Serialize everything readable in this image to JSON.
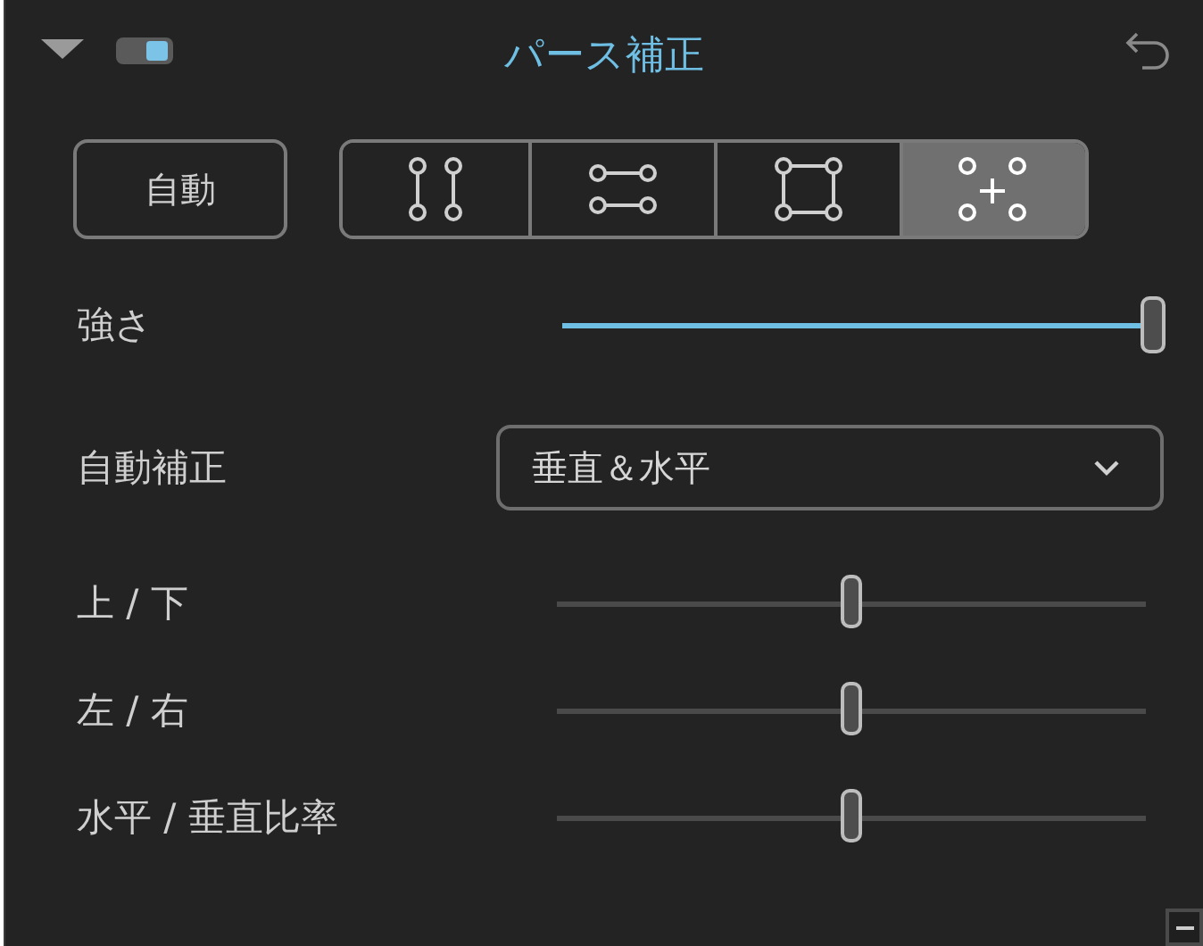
{
  "panel": {
    "expanded": true,
    "enabled": true,
    "title": "パース補正"
  },
  "auto_button": "自動",
  "modes": [
    {
      "kind": "vertical",
      "selected": false
    },
    {
      "kind": "horizontal",
      "selected": false
    },
    {
      "kind": "full",
      "selected": false
    },
    {
      "kind": "guided",
      "selected": true
    }
  ],
  "strength": {
    "label": "強さ",
    "level": 1
  },
  "auto_correction": {
    "label": "自動補正",
    "value": "垂直＆水平"
  },
  "sliders": [
    {
      "label": "上 / 下",
      "level": 0.5
    },
    {
      "label": "左 / 右",
      "level": 0.5
    },
    {
      "label": "水平 / 垂直比率",
      "level": 0.5
    }
  ]
}
